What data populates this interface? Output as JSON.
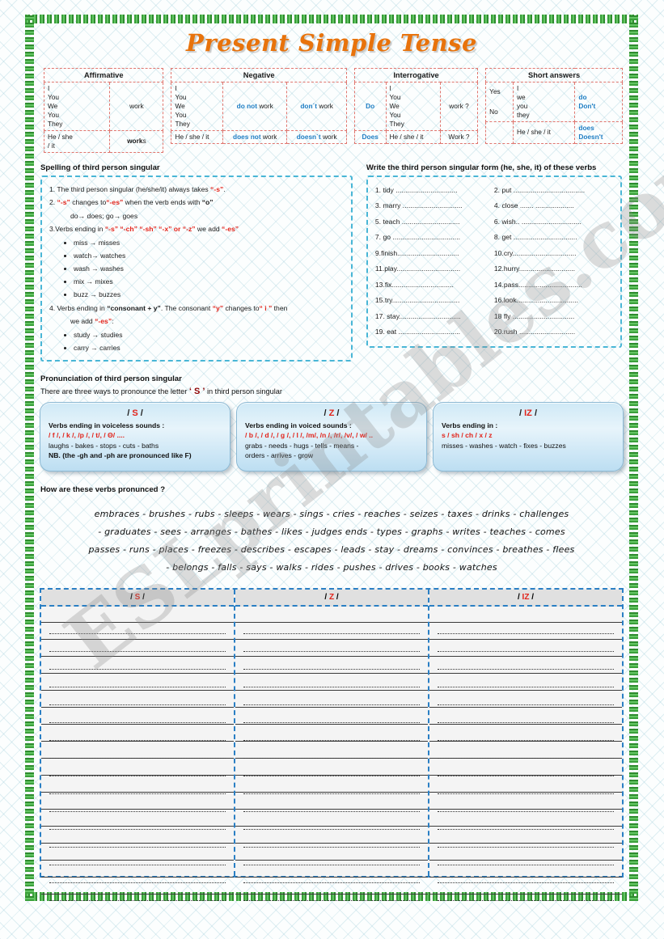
{
  "page": {
    "title": "Present Simple Tense",
    "watermark": "ESLprintables.com"
  },
  "grammar_tables": {
    "affirmative": {
      "header": "Affirmative",
      "subjects": [
        "I",
        "You",
        "We",
        "You",
        "They"
      ],
      "verb": "work",
      "third_subject": "He / she / it",
      "third_verb_bold": "work",
      "third_verb_suffix": "s"
    },
    "negative": {
      "header": "Negative",
      "subjects": [
        "I",
        "You",
        "We",
        "You",
        "They"
      ],
      "long_aux": "do not",
      "long_verb": "work",
      "short_aux": "don´t",
      "short_verb": "work",
      "third_subject": "He / she / it",
      "third_long_aux": "does not",
      "third_long_verb": "work",
      "third_short_aux": "doesn´t",
      "third_short_verb": "work"
    },
    "interrogative": {
      "header": "Interrogative",
      "aux": "Do",
      "subjects": [
        "I",
        "You",
        "We",
        "You",
        "They"
      ],
      "verb": "work ?",
      "third_aux": "Does",
      "third_subject": "He / she / it",
      "third_verb": "Work ?"
    },
    "short_answers": {
      "header": "Short answers",
      "yes": "Yes",
      "no": "No",
      "subjects": [
        "I",
        "we",
        "you",
        "they"
      ],
      "aux_positive": "do",
      "aux_negative": "Don't",
      "third_subject": "He / she / it",
      "third_aux_positive": "does",
      "third_aux_negative": "Doesn't"
    }
  },
  "spelling": {
    "heading": "Spelling of third person singular",
    "rule1_pre": "1. The third person singular (he/she/it) always takes ",
    "rule1_quote": "“-s”",
    "rule1_post": ".",
    "rule2_a": "2.  ",
    "rule2_q1": "“-s”",
    "rule2_b": " changes to",
    "rule2_q2": "“-es”",
    "rule2_c": " when the verb ends with ",
    "rule2_q3": "“o”",
    "rule2_examples": "do→  does;            go→   goes",
    "rule3_a": "3.Verbs ending in ",
    "rule3_endings": "“-s”  “-ch”  “-sh”  “-x”  or  “-z”",
    "rule3_b": "  we add ",
    "rule3_q": "“-es”",
    "rule3_examples": [
      "miss →  misses",
      "watch→  watches",
      "wash →  washes",
      "mix →  mixes",
      "buzz →  buzzes"
    ],
    "rule4_a": "4. Verbs ending in ",
    "rule4_b": "“consonant + y”",
    "rule4_c": ". The consonant ",
    "rule4_y": "“y”",
    "rule4_d": "  changes to",
    "rule4_i": "“ i ”",
    "rule4_e": " then",
    "rule4_f": "we add ",
    "rule4_es": "“-es”",
    "rule4_colon": ":",
    "rule4_examples": [
      "study →  studies",
      "carry →  carries"
    ]
  },
  "exercise": {
    "heading": "Write the third person singular form (he, she, it) of these verbs",
    "items_left": [
      "1. tidy ................................",
      "3. marry ...............................",
      "5. teach ..............................",
      "7. go ...................................",
      "9.finish................................",
      "11.play.................................",
      "13.fix................................",
      "15.try...................................",
      "17. stay................................",
      "19. eat ................................"
    ],
    "items_right": [
      "2. put .....................................",
      "4. close ....... ....................",
      "6. wish.. ...............................",
      "8. get .................................",
      "10.cry.................................",
      "12.hurry.............................",
      "14.pass.................................",
      "16.look................................",
      "18 fly ................................",
      "20.rush ............................."
    ]
  },
  "pronunciation": {
    "heading": "Pronunciation of third person singular",
    "intro_pre": "There are three ways to pronounce the letter ",
    "intro_letter": "‘ S ’",
    "intro_post": " in third person singular",
    "cards": [
      {
        "symbol_open": "/ ",
        "symbol": "S",
        "symbol_close": " /",
        "description": "Verbs ending in voiceless sounds :",
        "phonetics": "/ f /, / k /, /p /, / t/, / Θ/ ....",
        "examples": "laughs  -  bakes - stops  - cuts  -  baths",
        "note": "NB. (the -gh and -ph are pronounced like F)"
      },
      {
        "symbol_open": "/ ",
        "symbol": "Z",
        "symbol_close": " /",
        "description": "Verbs ending in  voiced sounds :",
        "phonetics": "/ b /, / d /, / g /, / l /, /m/, /n /, /r/, /v/, / w/ ..",
        "examples": "grabs  -  needs -  hugs  -  tells  -  means  -",
        "note": "orders  -  arrives   -  grow"
      },
      {
        "symbol_open": "/ ",
        "symbol": "IZ",
        "symbol_close": " /",
        "description": "Verbs ending in :",
        "phonetics": "s  /  sh  /  ch /  x  /  z",
        "examples": "misses  -  washes  -  watch  -  fixes  -  buzzes",
        "note": ""
      }
    ]
  },
  "practice": {
    "heading": "How are these verbs pronunced ?",
    "lines": [
      "embraces  -  brushes  -  rubs  -  sleeps  -  wears  -  sings   -  cries  -  reaches  -  seizes  -  taxes  -  drinks  -  challenges",
      "-  graduates  -  sees  -  arranges   -  bathes  -  likes  -  judges ends  -  types  -  graphs  -  writes  -  teaches  -  comes",
      "passes  -  runs   -  places  -  freezes   -  describes   -  escapes  -  leads  -  stay  -  dreams  -  convinces  -  breathes  - flees",
      "-  belongs  -  falls   -  says  -  walks  -  rides  -  pushes  -  drives  -  books  -  watches"
    ]
  },
  "answer_table": {
    "columns": [
      {
        "symbol_open": "/ ",
        "symbol": "S",
        "symbol_close": " /"
      },
      {
        "symbol_open": "/ ",
        "symbol": "Z",
        "symbol_close": " /"
      },
      {
        "symbol_open": "/ ",
        "symbol": "IZ",
        "symbol_close": " /"
      }
    ],
    "line_count": 16
  }
}
